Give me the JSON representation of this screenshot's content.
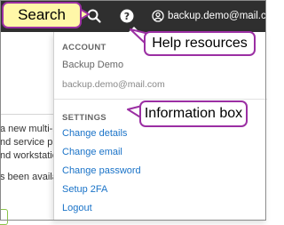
{
  "topbar": {
    "search_icon": "search-icon",
    "help_icon": "help-question-icon",
    "account": {
      "icon": "user-circle-icon",
      "email": "backup.demo@mail.com"
    }
  },
  "dropdown": {
    "account_label": "ACCOUNT",
    "account_name": "Backup Demo",
    "account_email": "backup.demo@mail.com",
    "settings_label": "SETTINGS",
    "settings_items": [
      "Change details",
      "Change email",
      "Change password",
      "Setup 2FA",
      "Logout"
    ]
  },
  "background_text": [
    "a new multi-ins",
    "nd service provi",
    "nd workstations",
    "s been availab"
  ],
  "callouts": {
    "search": "Search",
    "help": "Help resources",
    "info": "Information box"
  },
  "colors": {
    "topbar": "#2f2f2f",
    "callout_border": "#9b2fa3",
    "search_callout_fill": "#fff7a8",
    "link": "#1a73c8"
  }
}
